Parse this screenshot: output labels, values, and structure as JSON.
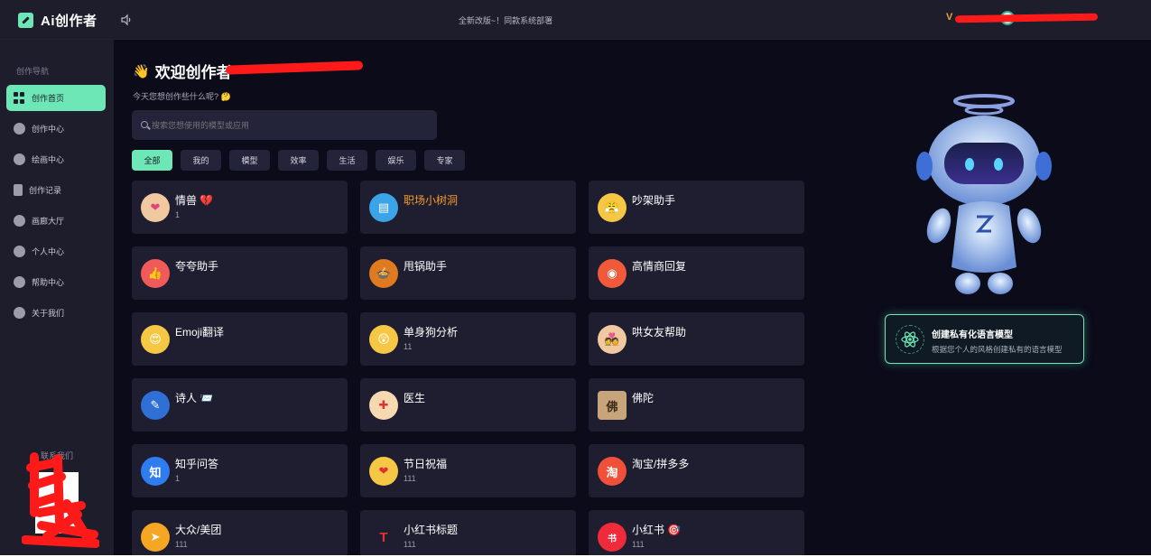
{
  "app": {
    "name": "Ai创作者"
  },
  "topbar": {
    "notice": "全新改版~！同款系统部署",
    "user_initial": "V"
  },
  "sidebar": {
    "title": "创作导航",
    "items": [
      {
        "label": "创作首页",
        "icon": "grid-icon",
        "active": true
      },
      {
        "label": "创作中心",
        "icon": "pen-icon"
      },
      {
        "label": "绘画中心",
        "icon": "palette-icon"
      },
      {
        "label": "创作记录",
        "icon": "document-icon"
      },
      {
        "label": "画廊大厅",
        "icon": "gallery-icon"
      },
      {
        "label": "个人中心",
        "icon": "user-icon"
      },
      {
        "label": "帮助中心",
        "icon": "help-icon"
      },
      {
        "label": "关于我们",
        "icon": "info-icon"
      }
    ],
    "contact": "联系我们"
  },
  "main": {
    "welcome": "欢迎创作者",
    "subtitle": "今天您想创作些什么呢?",
    "search_placeholder": "搜索您想使用的模型或应用",
    "tabs": [
      "全部",
      "我的",
      "模型",
      "效率",
      "生活",
      "娱乐",
      "专家"
    ],
    "cards": [
      {
        "title": "情兽 💔",
        "sub": "1",
        "icon": "couple-icon",
        "color": "#f0c9a0",
        "glyph": "❤"
      },
      {
        "title": "职场小树洞",
        "sub": "",
        "icon": "office-icon",
        "color": "#3ba3e8",
        "glyph": "▤",
        "accent": "#f59b2c"
      },
      {
        "title": "吵架助手",
        "sub": "",
        "icon": "angry-face-icon",
        "color": "#f6c744",
        "glyph": "😤"
      },
      {
        "title": "夸夸助手",
        "sub": "",
        "icon": "thumbs-up-icon",
        "color": "#f15a5a",
        "glyph": "👍"
      },
      {
        "title": "甩锅助手",
        "sub": "",
        "icon": "pot-icon",
        "color": "#e07a1f",
        "glyph": "🍲"
      },
      {
        "title": "高情商回复",
        "sub": "",
        "icon": "chat-bubble-icon",
        "color": "#f05a3a",
        "glyph": "◉"
      },
      {
        "title": "Emoji翻译",
        "sub": "",
        "icon": "heart-eyes-icon",
        "color": "#f6c744",
        "glyph": "😍"
      },
      {
        "title": "单身狗分析",
        "sub": "11",
        "icon": "shocked-face-icon",
        "color": "#f6c744",
        "glyph": "😲"
      },
      {
        "title": "哄女友帮助",
        "sub": "",
        "icon": "couple-icon",
        "color": "#f0c9a0",
        "glyph": "💑"
      },
      {
        "title": "诗人 📨",
        "sub": "",
        "icon": "quill-icon",
        "color": "#2f6fd6",
        "glyph": "✎"
      },
      {
        "title": "医生",
        "sub": "",
        "icon": "doctor-icon",
        "color": "#f6d9b0",
        "glyph": "✚"
      },
      {
        "title": "佛陀",
        "sub": "",
        "icon": "buddha-icon",
        "color": "#c8a47a",
        "glyph": "佛"
      },
      {
        "title": "知乎问答",
        "sub": "1",
        "icon": "zhihu-icon",
        "color": "#2f7bf0",
        "glyph": "知"
      },
      {
        "title": "节日祝福",
        "sub": "111",
        "icon": "heart-icon",
        "color": "#f6c744",
        "glyph": "❤"
      },
      {
        "title": "淘宝/拼多多",
        "sub": "",
        "icon": "taobao-icon",
        "color": "#f0503a",
        "glyph": "淘"
      },
      {
        "title": "大众/美团",
        "sub": "111",
        "icon": "meituan-icon",
        "color": "#f5a623",
        "glyph": "➤"
      },
      {
        "title": "小红书标题",
        "sub": "111",
        "icon": "title-icon",
        "color": "#e8302f",
        "glyph": "T"
      },
      {
        "title": "小红书 🎯",
        "sub": "111",
        "icon": "xiaohongshu-icon",
        "color": "#ef2a3a",
        "glyph": "书"
      }
    ]
  },
  "promo": {
    "title": "创建私有化语言模型",
    "desc": "根据您个人的风格创建私有的语言模型"
  }
}
